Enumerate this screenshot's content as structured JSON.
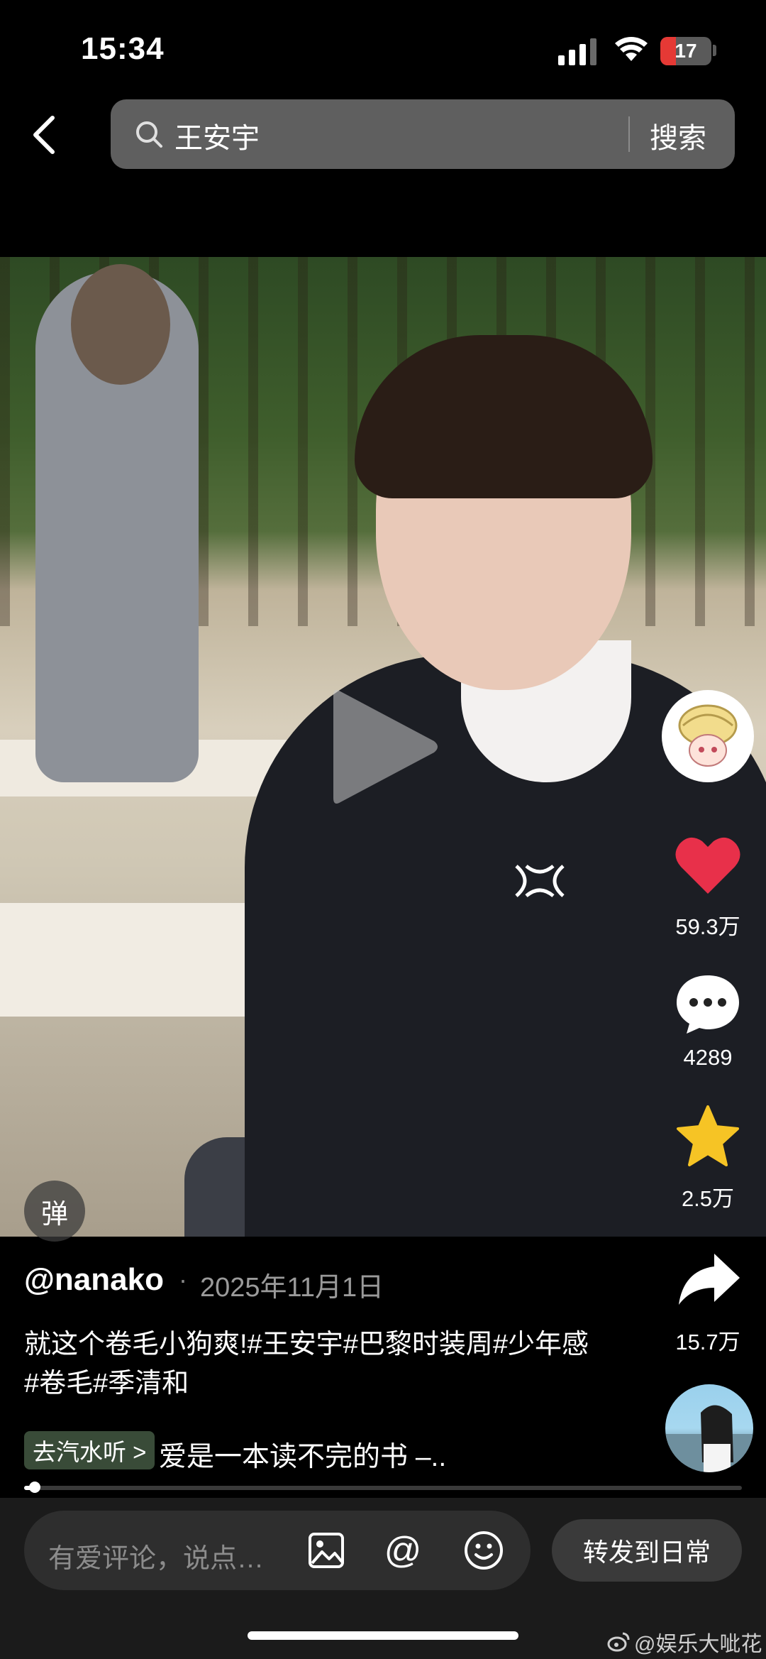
{
  "status_bar": {
    "time": "15:34",
    "battery": "17",
    "battery_color": "#e53935"
  },
  "search": {
    "value": "王安宇",
    "button_label": "搜索"
  },
  "video": {
    "danmu_label": "弹",
    "progress": 0.015
  },
  "actions": {
    "like_count": "59.3万",
    "comment_count": "4289",
    "favorite_count": "2.5万",
    "share_count": "15.7万",
    "like_color": "#e8304a",
    "favorite_color": "#f6c425"
  },
  "post": {
    "username": "@nanako",
    "separator": "·",
    "date": "2025年11月1日",
    "caption": "就这个卷毛小狗爽!#王安宇#巴黎时装周#少年感 #卷毛#季清和",
    "music_tag": "去汽水听 >",
    "music_title": "爱是一本读不完的书 –.."
  },
  "bottom_bar": {
    "comment_placeholder": "有爱评论，说点…",
    "at_symbol": "@",
    "forward_label": "转发到日常"
  },
  "watermark": "@娱乐大呲花"
}
